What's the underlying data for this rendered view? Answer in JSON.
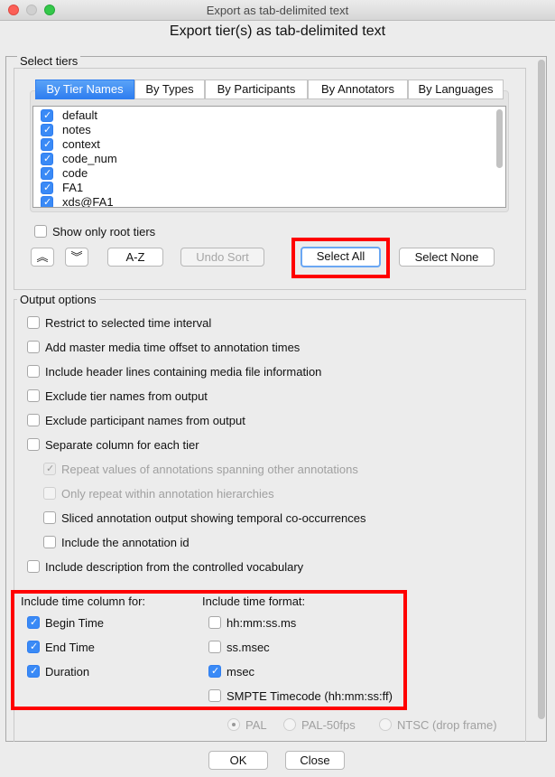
{
  "window": {
    "title": "Export as tab-delimited text",
    "header": "Export tier(s) as tab-delimited text"
  },
  "select_tiers": {
    "label": "Select tiers",
    "tabs": [
      {
        "label": "By Tier Names",
        "active": true
      },
      {
        "label": "By Types"
      },
      {
        "label": "By Participants"
      },
      {
        "label": "By Annotators"
      },
      {
        "label": "By Languages"
      }
    ],
    "tiers": [
      {
        "name": "default",
        "checked": true
      },
      {
        "name": "notes",
        "checked": true
      },
      {
        "name": "context",
        "checked": true
      },
      {
        "name": "code_num",
        "checked": true
      },
      {
        "name": "code",
        "checked": true
      },
      {
        "name": "FA1",
        "checked": true
      },
      {
        "name": "xds@FA1",
        "checked": true
      }
    ],
    "show_only_root": {
      "label": "Show only root tiers",
      "checked": false
    },
    "buttons": {
      "up": "up-arrow",
      "down": "down-arrow",
      "az": "A-Z",
      "undo_sort": "Undo Sort",
      "select_all": "Select All",
      "select_none": "Select None"
    }
  },
  "output": {
    "label": "Output options",
    "options": [
      {
        "label": "Restrict to selected time interval",
        "checked": false
      },
      {
        "label": "Add master media time offset to annotation times",
        "checked": false
      },
      {
        "label": "Include header lines containing media file information",
        "checked": false
      },
      {
        "label": "Exclude tier names from output",
        "checked": false
      },
      {
        "label": "Exclude participant names from output",
        "checked": false
      },
      {
        "label": "Separate column for each tier",
        "checked": false
      },
      {
        "label": "Repeat values of annotations spanning other annotations",
        "checked": true,
        "disabled": true
      },
      {
        "label": "Only repeat within annotation hierarchies",
        "checked": false,
        "disabled": true
      },
      {
        "label": "Sliced annotation output showing temporal co-occurrences",
        "checked": false
      },
      {
        "label": "Include the annotation id",
        "checked": false
      },
      {
        "label": "Include description from the controlled vocabulary",
        "checked": false
      }
    ],
    "time_column_label": "Include time column for:",
    "time_columns": [
      {
        "label": "Begin Time",
        "checked": true
      },
      {
        "label": "End Time",
        "checked": true
      },
      {
        "label": "Duration",
        "checked": true
      }
    ],
    "time_format_label": "Include time format:",
    "time_formats": [
      {
        "label": "hh:mm:ss.ms",
        "checked": false
      },
      {
        "label": "ss.msec",
        "checked": false
      },
      {
        "label": "msec",
        "checked": true
      },
      {
        "label": "SMPTE Timecode (hh:mm:ss:ff)",
        "checked": false
      }
    ],
    "smpte": [
      {
        "label": "PAL",
        "selected": true
      },
      {
        "label": "PAL-50fps",
        "selected": false
      },
      {
        "label": "NTSC (drop frame)",
        "selected": false
      }
    ]
  },
  "footer": {
    "ok": "OK",
    "close": "Close"
  },
  "colors": {
    "accent": "#2f7ef0",
    "highlight": "#ff0000"
  }
}
